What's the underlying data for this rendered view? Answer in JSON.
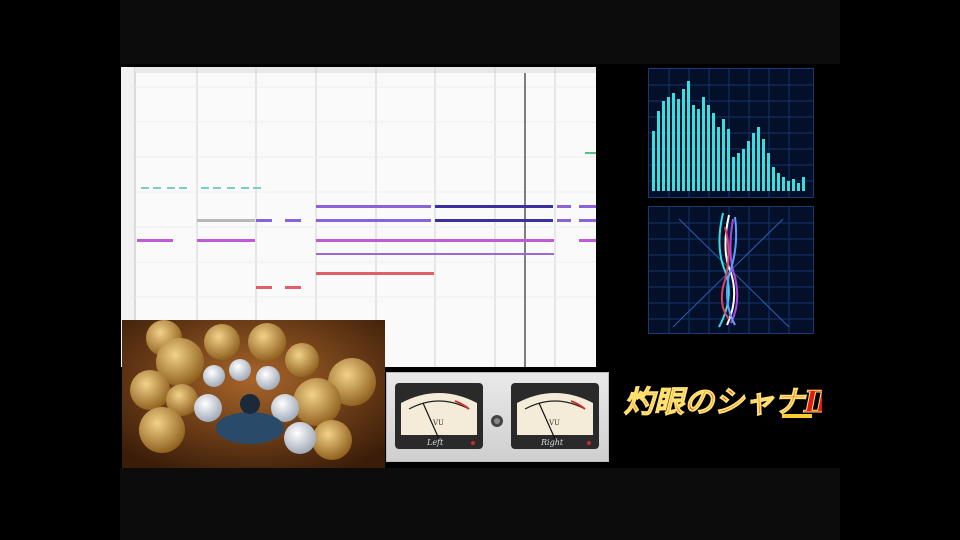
{
  "vu_meters": {
    "left": {
      "scale": "VU",
      "label": "Left"
    },
    "right": {
      "scale": "VU",
      "label": "Right"
    }
  },
  "logo": {
    "text": "灼眼のシャナⅢ"
  },
  "colors": {
    "background": "#000000",
    "note_purple": "#8a63d8",
    "note_navy": "#3a2f9e",
    "note_magenta": "#c05ad8",
    "note_red": "#e0606a",
    "note_teal": "#7ccfc0",
    "spectrum_bar": "#38e0e0"
  },
  "icons": [
    "drum-kit-icon",
    "vu-needle-icon",
    "select-knob-icon"
  ]
}
